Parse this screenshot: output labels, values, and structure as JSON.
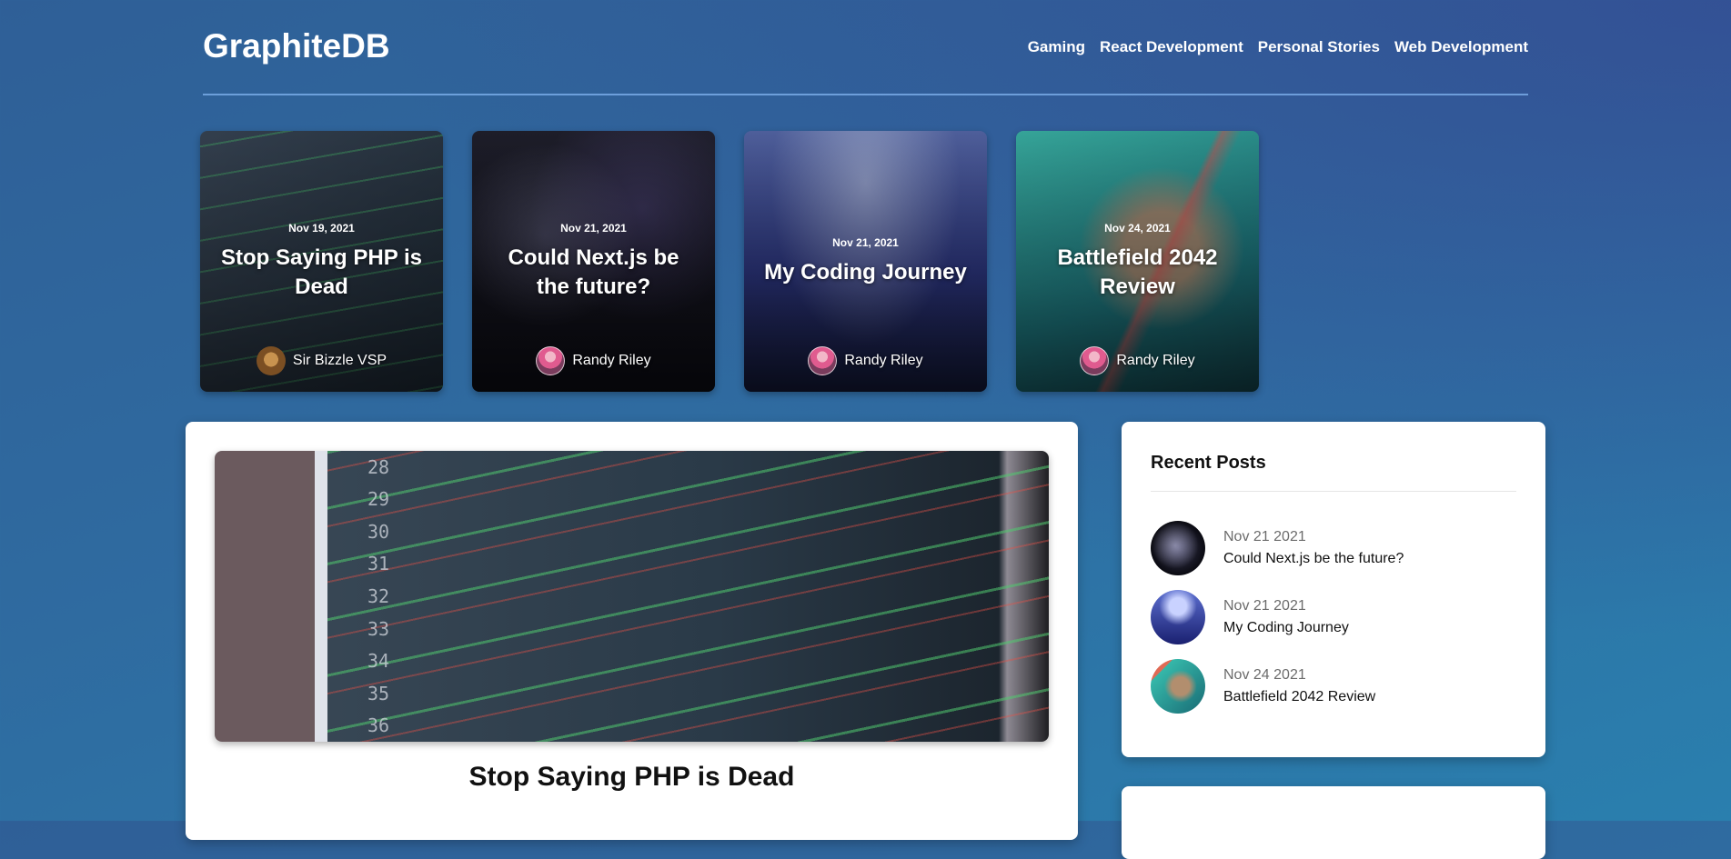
{
  "header": {
    "brand": "GraphiteDB",
    "nav": [
      "Gaming",
      "React Development",
      "Personal Stories",
      "Web Development"
    ]
  },
  "featured": [
    {
      "date": "Nov 19, 2021",
      "title": "Stop Saying PHP is Dead",
      "author": "Sir Bizzle VSP"
    },
    {
      "date": "Nov 21, 2021",
      "title": "Could Next.js be the future?",
      "author": "Randy Riley"
    },
    {
      "date": "Nov 21, 2021",
      "title": "My Coding Journey",
      "author": "Randy Riley"
    },
    {
      "date": "Nov 24, 2021",
      "title": "Battlefield 2042 Review",
      "author": "Randy Riley"
    }
  ],
  "main": {
    "title": "Stop Saying PHP is Dead",
    "hero_line_numbers": [
      "28",
      "29",
      "30",
      "31",
      "32",
      "33",
      "34",
      "35",
      "36"
    ]
  },
  "sidebar": {
    "heading": "Recent Posts",
    "posts": [
      {
        "date": "Nov 21 2021",
        "title": "Could Next.js be the future?"
      },
      {
        "date": "Nov 21 2021",
        "title": "My Coding Journey"
      },
      {
        "date": "Nov 24 2021",
        "title": "Battlefield 2042 Review"
      }
    ]
  }
}
